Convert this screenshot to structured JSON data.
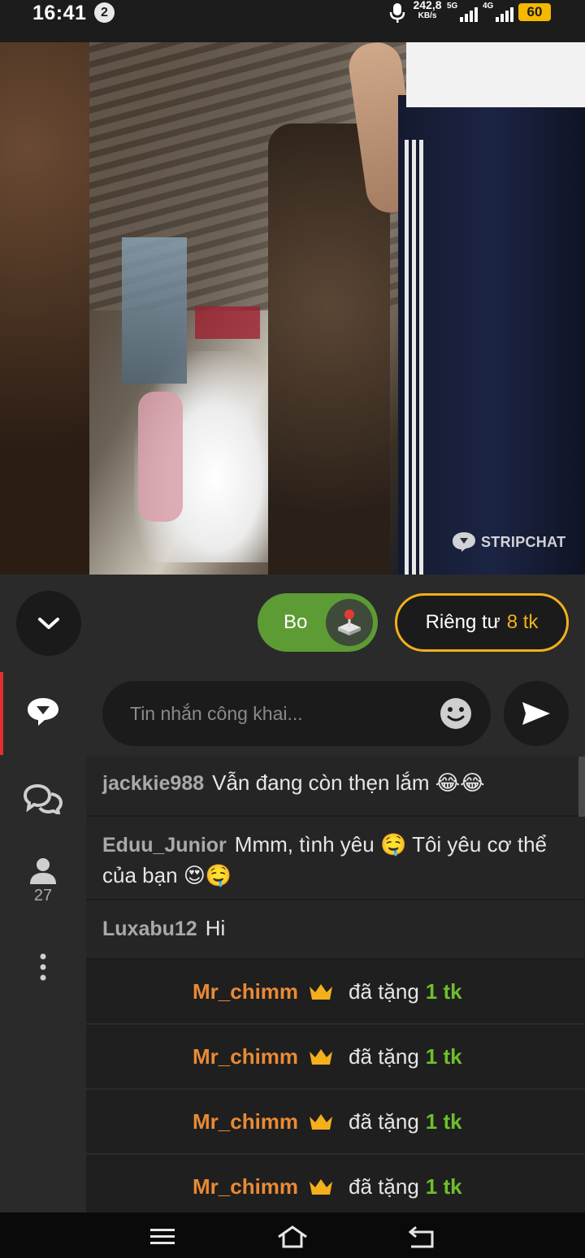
{
  "status_bar": {
    "time": "16:41",
    "notification_count": "2",
    "net_speed_value": "242,8",
    "net_speed_unit": "KB/s",
    "sim1_label": "5G",
    "sim2_label": "4G",
    "battery": "60"
  },
  "video": {
    "watermark": "STRIPCHAT"
  },
  "controls": {
    "tip_label": "Bo",
    "private_label": "Riêng tư",
    "private_price": "8 tk"
  },
  "rail": {
    "viewer_count": "27"
  },
  "chat": {
    "input_placeholder": "Tin nhắn công khai...",
    "messages": [
      {
        "user": "jackkie988",
        "text": "Vẫn đang còn thẹn lắm 😂😂"
      },
      {
        "user": "Eduu_Junior",
        "text": "Mmm, tình yêu 🤤 Tôi yêu cơ thể của bạn 😍🤤"
      },
      {
        "user": "Luxabu12",
        "text": "Hi"
      }
    ],
    "tips": [
      {
        "user": "Mr_chimm",
        "action": "đã tặng",
        "amount": "1 tk"
      },
      {
        "user": "Mr_chimm",
        "action": "đã tặng",
        "amount": "1 tk"
      },
      {
        "user": "Mr_chimm",
        "action": "đã tặng",
        "amount": "1 tk"
      },
      {
        "user": "Mr_chimm",
        "action": "đã tặng",
        "amount": "1 tk"
      }
    ]
  },
  "colors": {
    "accent_green": "#5d9b35",
    "accent_gold": "#f3b01b",
    "tipper_orange": "#e98a36",
    "tip_amount_green": "#6ebf2c",
    "active_red": "#e0312f"
  }
}
